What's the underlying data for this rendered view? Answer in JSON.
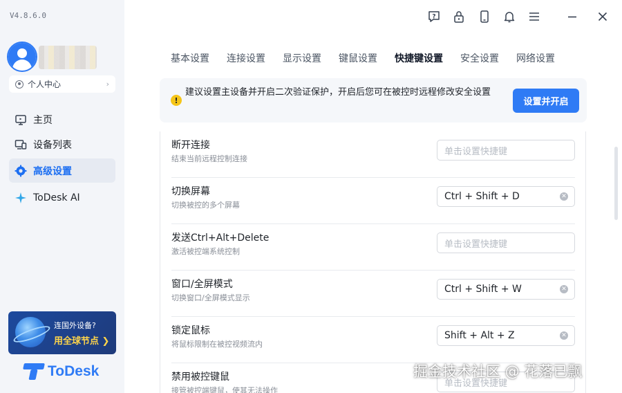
{
  "app": {
    "version": "V4.8.6.0",
    "logo_text": "ToDesk"
  },
  "sidebar": {
    "personal_center": "个人中心",
    "items": [
      {
        "label": "主页",
        "icon": "monitor-icon",
        "active": false
      },
      {
        "label": "设备列表",
        "icon": "devices-icon",
        "active": false
      },
      {
        "label": "高级设置",
        "icon": "gear-icon",
        "active": true
      },
      {
        "label": "ToDesk AI",
        "icon": "sparkle-icon",
        "active": false
      }
    ],
    "promo": {
      "line1": "连国外设备?",
      "line2": "用全球节点 ❯"
    }
  },
  "topbar": {
    "icons": [
      "help-icon",
      "lock-icon",
      "phone-icon",
      "bell-icon",
      "menu-icon",
      "minimize-icon",
      "close-icon"
    ]
  },
  "tabs": [
    {
      "label": "基本设置",
      "active": false
    },
    {
      "label": "连接设置",
      "active": false
    },
    {
      "label": "显示设置",
      "active": false
    },
    {
      "label": "键鼠设置",
      "active": false
    },
    {
      "label": "快捷键设置",
      "active": true
    },
    {
      "label": "安全设置",
      "active": false
    },
    {
      "label": "网络设置",
      "active": false
    }
  ],
  "banner": {
    "text": "建议设置主设备并开启二次验证保护，开启后您可在被控时远程修改安全设置",
    "button": "设置并开启"
  },
  "shortcuts": [
    {
      "title": "断开连接",
      "desc": "结束当前远程控制连接",
      "value": "",
      "placeholder": "单击设置快捷键"
    },
    {
      "title": "切换屏幕",
      "desc": "切换被控的多个屏幕",
      "value": "Ctrl + Shift + D",
      "placeholder": ""
    },
    {
      "title": "发送Ctrl+Alt+Delete",
      "desc": "激活被控端系统控制",
      "value": "",
      "placeholder": "单击设置快捷键"
    },
    {
      "title": "窗口/全屏模式",
      "desc": "切换窗口/全屏模式显示",
      "value": "Ctrl + Shift + W",
      "placeholder": ""
    },
    {
      "title": "锁定鼠标",
      "desc": "将鼠标限制在被控视频流内",
      "value": "Shift + Alt + Z",
      "placeholder": ""
    },
    {
      "title": "禁用被控键鼠",
      "desc": "接管被控端键鼠，使其无法操作",
      "value": "",
      "placeholder": "单击设置快捷键"
    }
  ],
  "watermark": "掘金技术社区 @ 花落已飘",
  "colors": {
    "accent": "#2f7bf5",
    "sidebar_bg": "#f3f5f9",
    "warning": "#f5c518"
  }
}
